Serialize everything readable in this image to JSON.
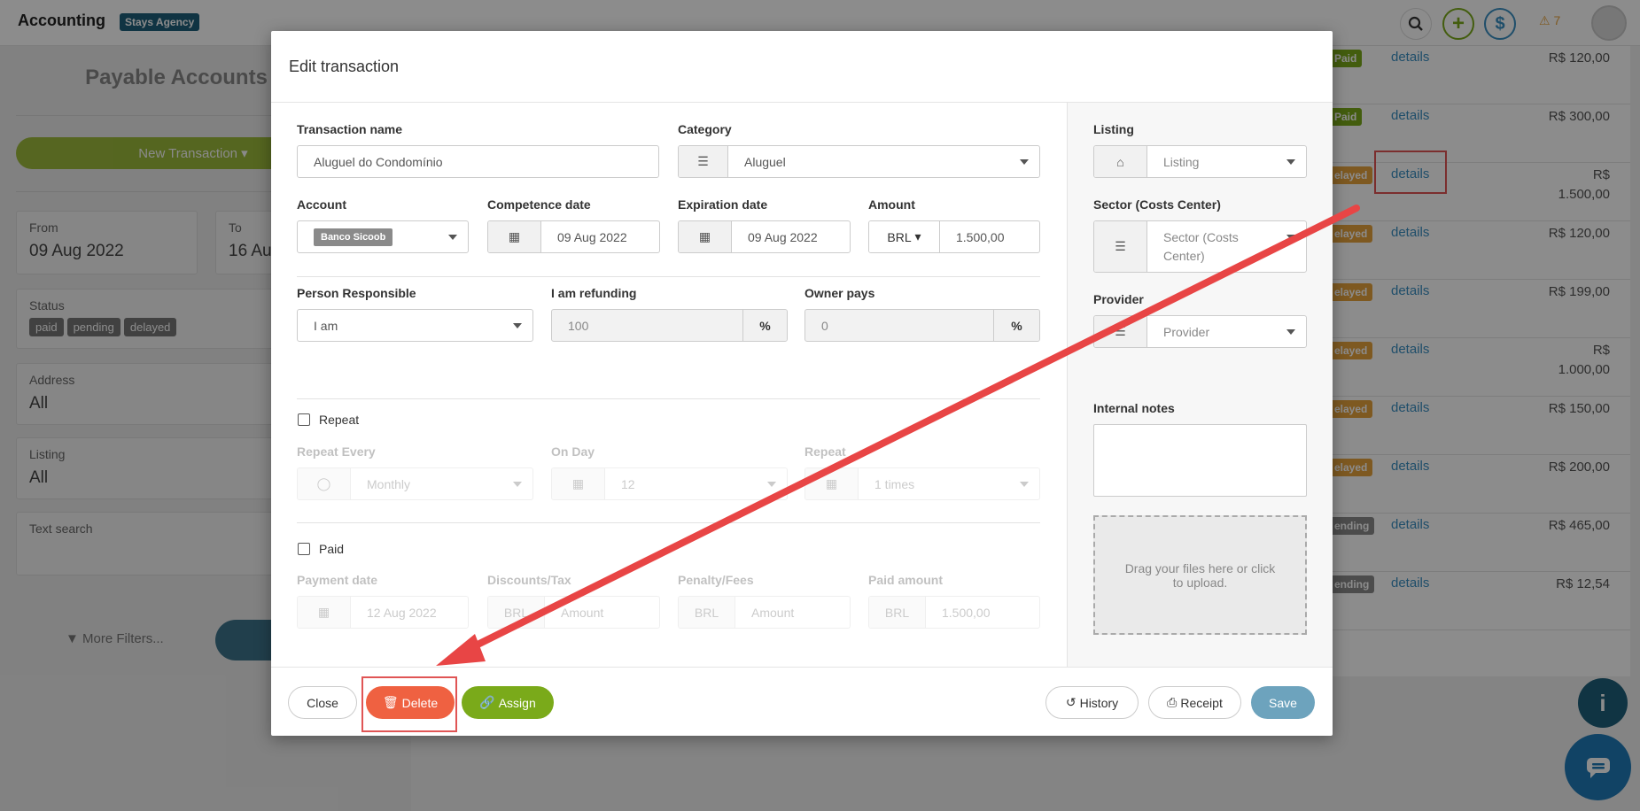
{
  "app": {
    "title": "Accounting",
    "agency": "Stays Agency",
    "alerts_count": "7"
  },
  "topbar": {
    "search_icon": "search-icon",
    "add_icon": "plus-icon",
    "money_icon": "dollar-icon"
  },
  "sidebar": {
    "title": "Payable Accounts",
    "new_transaction": "New Transaction",
    "from_label": "From",
    "from_value": "09 Aug 2022",
    "to_label": "To",
    "to_value": "16 Au",
    "status_label": "Status",
    "status_tags": [
      "paid",
      "pending",
      "delayed"
    ],
    "address_label": "Address",
    "address_value": "All",
    "listing_label": "Listing",
    "listing_value": "All",
    "text_search_label": "Text search",
    "more_filters": "More Filters..."
  },
  "table": {
    "rows": [
      {
        "status": "Paid",
        "link": "details",
        "amount": "R$ 120,00"
      },
      {
        "status": "Paid",
        "link": "details",
        "amount": "R$ 300,00"
      },
      {
        "status": "elayed",
        "link": "details",
        "amount_line1": "R$",
        "amount_line2": "1.500,00"
      },
      {
        "status": "elayed",
        "link": "details",
        "amount": "R$ 120,00"
      },
      {
        "status": "elayed",
        "link": "details",
        "amount": "R$ 199,00"
      },
      {
        "status": "elayed",
        "link": "details",
        "amount_line1": "R$",
        "amount_line2": "1.000,00"
      },
      {
        "status": "elayed",
        "link": "details",
        "amount": "R$ 150,00"
      },
      {
        "status": "elayed",
        "link": "details",
        "amount": "R$ 200,00"
      },
      {
        "status": "ending",
        "link": "details",
        "amount": "R$ 465,00"
      },
      {
        "status": "ending",
        "link": "details",
        "amount": "R$ 12,54"
      }
    ]
  },
  "modal": {
    "title": "Edit transaction",
    "transaction_name_label": "Transaction name",
    "transaction_name_value": "Aluguel do Condomínio",
    "category_label": "Category",
    "category_value": "Aluguel",
    "account_label": "Account",
    "account_value": "Banco Sicoob",
    "competence_label": "Competence date",
    "competence_value": "09 Aug 2022",
    "expiration_label": "Expiration date",
    "expiration_value": "09 Aug 2022",
    "amount_label": "Amount",
    "currency": "BRL",
    "amount_value": "1.500,00",
    "person_label": "Person Responsible",
    "person_value": "I am",
    "refunding_label": "I am refunding",
    "refunding_value": "100",
    "percent": "%",
    "owner_pays_label": "Owner pays",
    "owner_pays_value": "0",
    "repeat_label": "Repeat",
    "repeat_every_label": "Repeat Every",
    "repeat_every_value": "Monthly",
    "on_day_label": "On Day",
    "on_day_value": "12",
    "repeat_times_label": "Repeat",
    "repeat_times_value": "1 times",
    "paid_label": "Paid",
    "payment_date_label": "Payment date",
    "payment_date_value": "12 Aug 2022",
    "discounts_label": "Discounts/Tax",
    "discounts_currency": "BRL",
    "discounts_placeholder": "Amount",
    "penalty_label": "Penalty/Fees",
    "penalty_currency": "BRL",
    "penalty_placeholder": "Amount",
    "paid_amount_label": "Paid amount",
    "paid_amount_currency": "BRL",
    "paid_amount_value": "1.500,00",
    "listing_label": "Listing",
    "listing_placeholder": "Listing",
    "sector_label": "Sector (Costs Center)",
    "sector_placeholder": "Sector (Costs Center)",
    "provider_label": "Provider",
    "provider_placeholder": "Provider",
    "notes_label": "Internal notes",
    "dropzone_text": "Drag your files here or click to upload.",
    "buttons": {
      "close": "Close",
      "delete": "Delete",
      "assign": "Assign",
      "history": "History",
      "receipt": "Receipt",
      "save": "Save"
    }
  },
  "colors": {
    "primary": "#1e5f7a",
    "green": "#7aaa1a",
    "delete": "#ef6141",
    "save": "#6da3bd",
    "paid_badge": "#7aaa1a",
    "delayed_badge": "#e6a23c",
    "pending_badge": "#8a8a8a",
    "annotation": "#e84545"
  }
}
